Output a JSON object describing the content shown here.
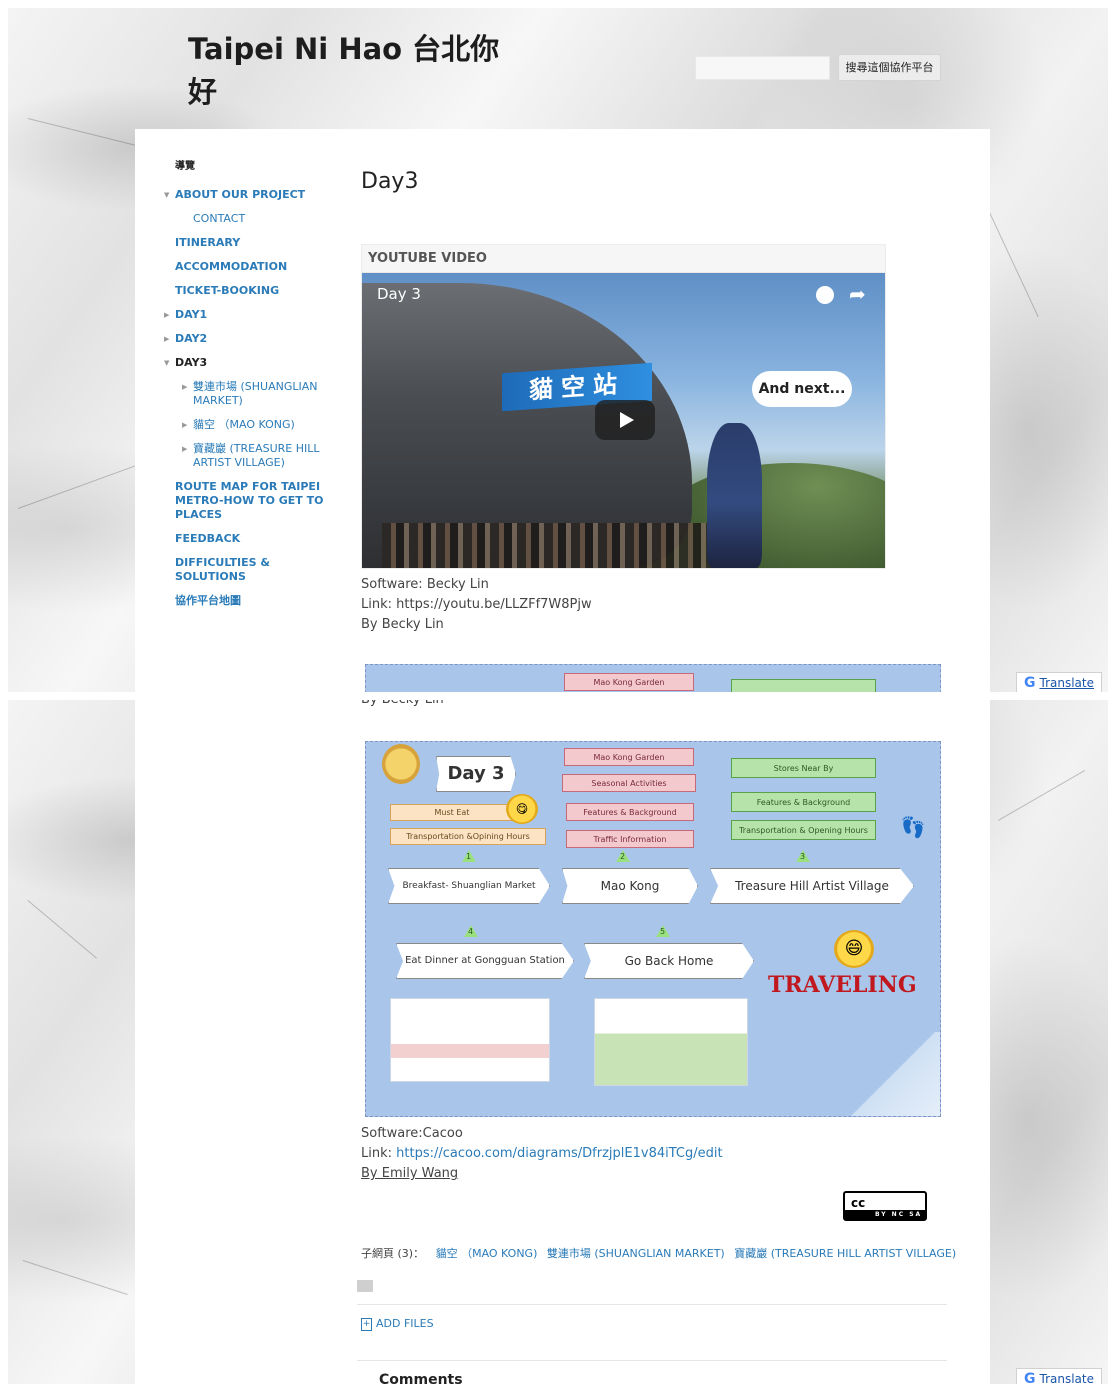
{
  "site": {
    "title": "Taipei Ni Hao 台北你好",
    "search_button": "搜尋這個協作平台",
    "search_placeholder": ""
  },
  "nav": {
    "heading": "導覽",
    "items": [
      {
        "label": "ABOUT OUR PROJECT",
        "level": 0,
        "expanded": true
      },
      {
        "label": "CONTACT",
        "level": 1
      },
      {
        "label": "ITINERARY",
        "level": 0
      },
      {
        "label": "ACCOMMODATION",
        "level": 0
      },
      {
        "label": "TICKET-BOOKING",
        "level": 0
      },
      {
        "label": "DAY1",
        "level": 0,
        "collapsed": true
      },
      {
        "label": "DAY2",
        "level": 0,
        "collapsed": true
      },
      {
        "label": "DAY3",
        "level": 0,
        "expanded": true,
        "active": true
      },
      {
        "label": "雙連市場 (SHUANGLIAN MARKET)",
        "level": 1
      },
      {
        "label": "貓空 （MAO KONG)",
        "level": 1
      },
      {
        "label": "寶藏巖 (TREASURE HILL ARTIST VILLAGE)",
        "level": 1
      },
      {
        "label": "ROUTE MAP FOR TAIPEI METRO-HOW TO GET TO PLACES",
        "level": 0
      },
      {
        "label": "FEEDBACK",
        "level": 0
      },
      {
        "label": "DIFFICULTIES & SOLUTIONS",
        "level": 0
      },
      {
        "label": "協作平台地圖",
        "level": 0
      }
    ]
  },
  "page": {
    "title": "Day3",
    "youtube": {
      "header": "YOUTUBE VIDEO",
      "video_title": "Day 3",
      "station_sign": "貓空站",
      "bubble": "And next...",
      "software": "Software: Becky Lin",
      "link": "Link: https://youtu.be/LLZFf7W8Pjw",
      "by": "By Becky Lin"
    },
    "diagram": {
      "day_label": "Day 3",
      "mao_kong_boxes": [
        "Mao Kong Garden",
        "Seasonal Activities",
        "Features & Background",
        "Traffic Information"
      ],
      "treasure_boxes": [
        "Stores Near By",
        "Features & Background",
        "Transportation & Opening Hours"
      ],
      "market_boxes": [
        "Must Eat",
        "Transportation &Opining Hours"
      ],
      "steps": [
        "Breakfast- Shuanglian Market",
        "Mao Kong",
        "Treasure Hill Artist Village",
        "Eat Dinner at Gongguan Station",
        "Go Back Home"
      ],
      "step_numbers": [
        "1",
        "2",
        "3",
        "4",
        "5"
      ],
      "traveling": "TRAVELING"
    },
    "cacoo": {
      "software": "Software:Cacoo",
      "link_prefix": "Link: ",
      "link_url": "https://cacoo.com/diagrams/DfrzjplE1v84iTCg/edit",
      "by": "By Emily Wang"
    },
    "cc_badge": {
      "label": "cc",
      "strip": "BY NC SA"
    },
    "subpages_label": "子網頁 (3)：",
    "subpages": [
      "貓空 （MAO KONG)",
      "雙連市場 (SHUANGLIAN MARKET)",
      "寶藏巖 (TREASURE HILL ARTIST VILLAGE)"
    ],
    "add_files": "ADD FILES",
    "comments": "Comments",
    "cut_text": "By Becky Lin",
    "partial_diagram_box": "Mao Kong Garden"
  },
  "translate": "Translate",
  "colors": {
    "link": "#2a7bb8",
    "diagram_bg": "#a9c6ea",
    "traveling": "#c0181e"
  }
}
